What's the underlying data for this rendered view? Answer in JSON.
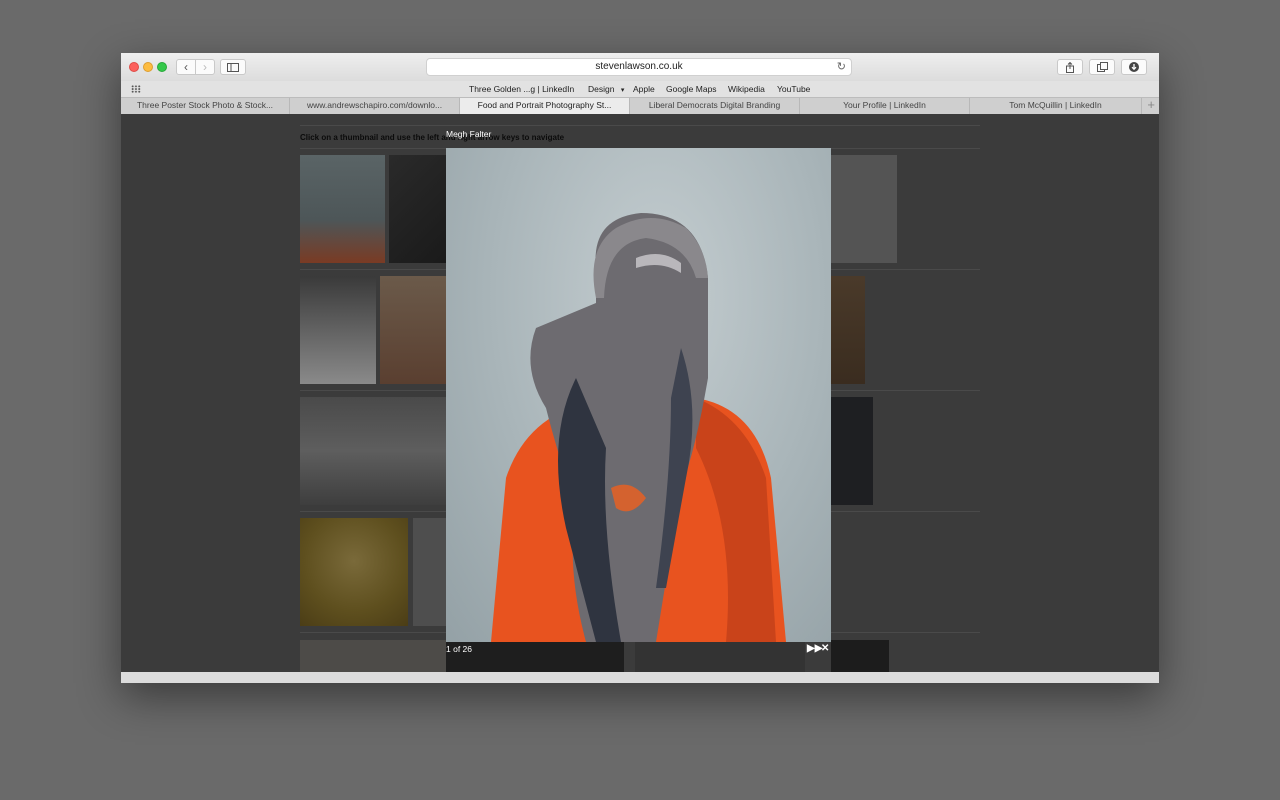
{
  "browser": {
    "url": "stevenlawson.co.uk",
    "bookmarks": [
      "Three Golden ...g | LinkedIn",
      "Design",
      "Apple",
      "Google Maps",
      "Wikipedia",
      "YouTube"
    ],
    "tabs": [
      "Three Poster Stock Photo & Stock...",
      "www.andrewschapiro.com/downlo...",
      "Food and Portrait Photography St...",
      "Liberal Democrats Digital Branding",
      "Your Profile | LinkedIn",
      "Tom McQuillin | LinkedIn"
    ],
    "active_tab": 2
  },
  "page": {
    "instructions": "Click on a thumbnail and use the left and right arrow keys to navigate"
  },
  "lightbox": {
    "caption": "Megh Falter",
    "counter": "1 of 26"
  },
  "icons": {
    "back": "chevron-left-icon",
    "forward": "chevron-right-icon",
    "sidebar": "sidebar-icon",
    "share": "share-icon",
    "tabs": "tabs-overview-icon",
    "download": "download-icon",
    "reload": "reload-icon",
    "slideshow": "fast-forward-icon",
    "close": "close-icon"
  },
  "colors": {
    "accent_orange": "#e8531f",
    "overlay": "#3b3b3b"
  }
}
